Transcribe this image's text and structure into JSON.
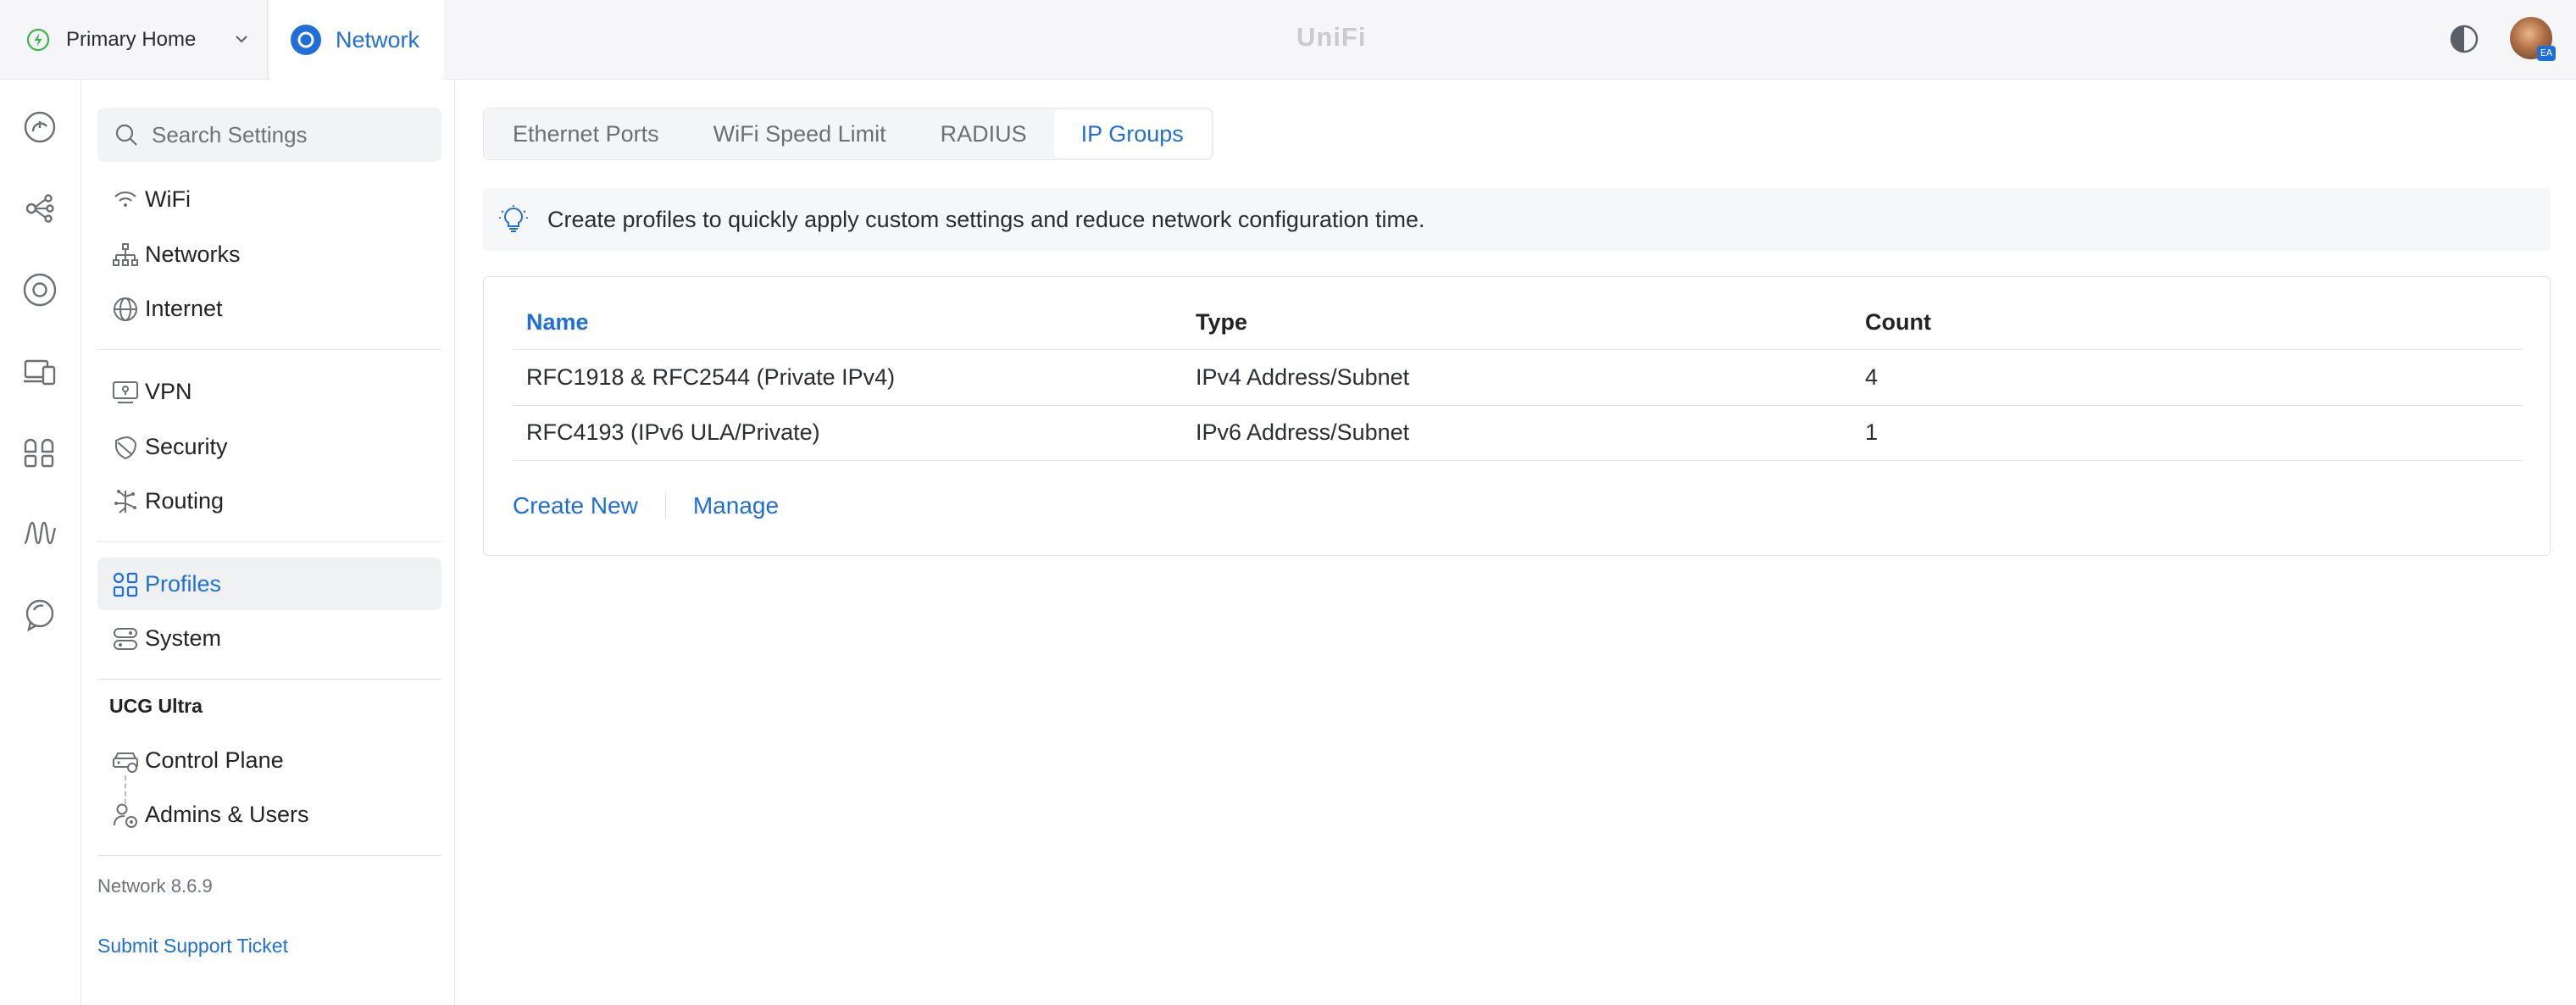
{
  "header": {
    "site_name": "Primary Home",
    "app_name": "Network",
    "brand": "UniFi",
    "avatar_initials": "EA"
  },
  "rail": {
    "icons": [
      "dashboard-icon",
      "topology-icon",
      "devices-icon",
      "clients-icon",
      "apps-icon",
      "insights-icon",
      "innerspace-icon"
    ]
  },
  "sidebar": {
    "search_placeholder": "Search Settings",
    "groups": [
      {
        "items": [
          {
            "label": "WiFi",
            "icon": "wifi-icon"
          },
          {
            "label": "Networks",
            "icon": "networks-icon"
          },
          {
            "label": "Internet",
            "icon": "globe-icon"
          }
        ]
      },
      {
        "items": [
          {
            "label": "VPN",
            "icon": "vpn-icon"
          },
          {
            "label": "Security",
            "icon": "shield-icon"
          },
          {
            "label": "Routing",
            "icon": "routing-icon"
          }
        ]
      },
      {
        "items": [
          {
            "label": "Profiles",
            "icon": "profiles-icon",
            "active": true
          },
          {
            "label": "System",
            "icon": "system-icon"
          }
        ]
      }
    ],
    "device_section": {
      "title": "UCG Ultra",
      "items": [
        {
          "label": "Control Plane",
          "icon": "control-plane-icon"
        },
        {
          "label": "Admins & Users",
          "icon": "admins-icon"
        }
      ]
    },
    "version": "Network 8.6.9",
    "support_link": "Submit Support Ticket"
  },
  "main": {
    "tabs": [
      {
        "label": "Ethernet Ports",
        "active": false
      },
      {
        "label": "WiFi Speed Limit",
        "active": false
      },
      {
        "label": "RADIUS",
        "active": false
      },
      {
        "label": "IP Groups",
        "active": true
      }
    ],
    "banner_text": "Create profiles to quickly apply custom settings and reduce network configuration time.",
    "table": {
      "columns": [
        "Name",
        "Type",
        "Count"
      ],
      "rows": [
        {
          "name": "RFC1918 & RFC2544 (Private IPv4)",
          "type": "IPv4 Address/Subnet",
          "count": "4"
        },
        {
          "name": "RFC4193 (IPv6 ULA/Private)",
          "type": "IPv6 Address/Subnet",
          "count": "1"
        }
      ]
    },
    "actions": {
      "create_label": "Create New",
      "manage_label": "Manage"
    }
  },
  "colors": {
    "accent": "#1f6fdb",
    "site_status": "#3cb54a",
    "muted": "#6e7279"
  }
}
